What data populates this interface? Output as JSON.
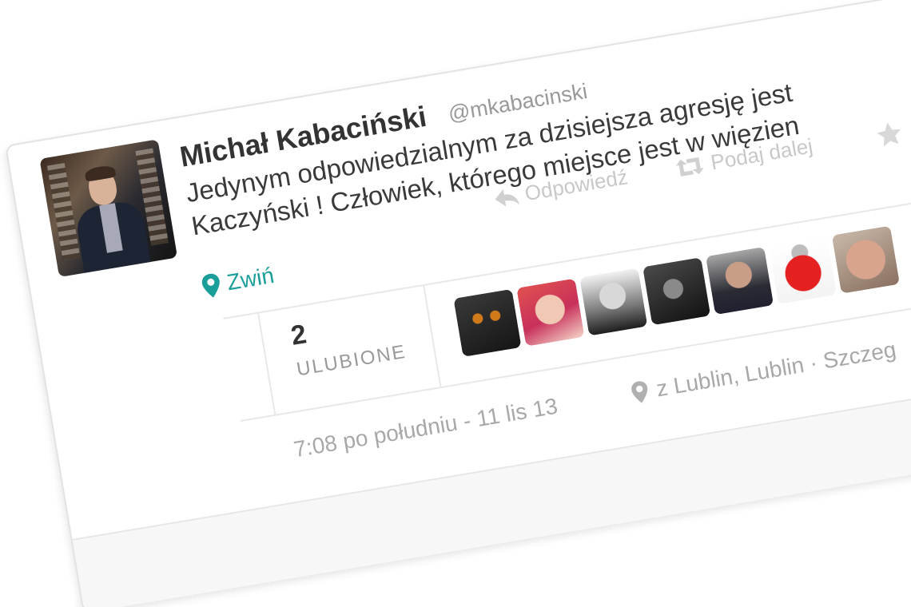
{
  "tweet": {
    "author_name": "Michał Kabaciński",
    "author_handle": "@mkabacinski",
    "text_line1": "Jedynym odpowiedzialnym za dzisiejsza agresję jest",
    "text_line2": "Kaczyński ! Człowiek, którego miejsce jest w więzien",
    "actions": {
      "reply_label": "Odpowiedź",
      "retweet_label": "Podaj dalej"
    },
    "collapse_label": "Zwiń",
    "stats": {
      "favorites_count": "2",
      "favorites_label": "ULUBIONE"
    },
    "timestamp": "7:08 po południu - 11 lis 13",
    "location": "z Lublin, Lublin · Szczeg",
    "favorited_by": [
      "cat",
      "woman",
      "man-mustache",
      "man-dark",
      "man-selfie",
      "coat-of-arms",
      "older-man"
    ]
  },
  "icons": {
    "reply": "reply-icon",
    "retweet": "retweet-icon",
    "favorite": "star-icon",
    "location": "map-pin-icon"
  },
  "colors": {
    "accent": "#1a9e9a",
    "text": "#3a3a3a",
    "muted": "#999999"
  }
}
